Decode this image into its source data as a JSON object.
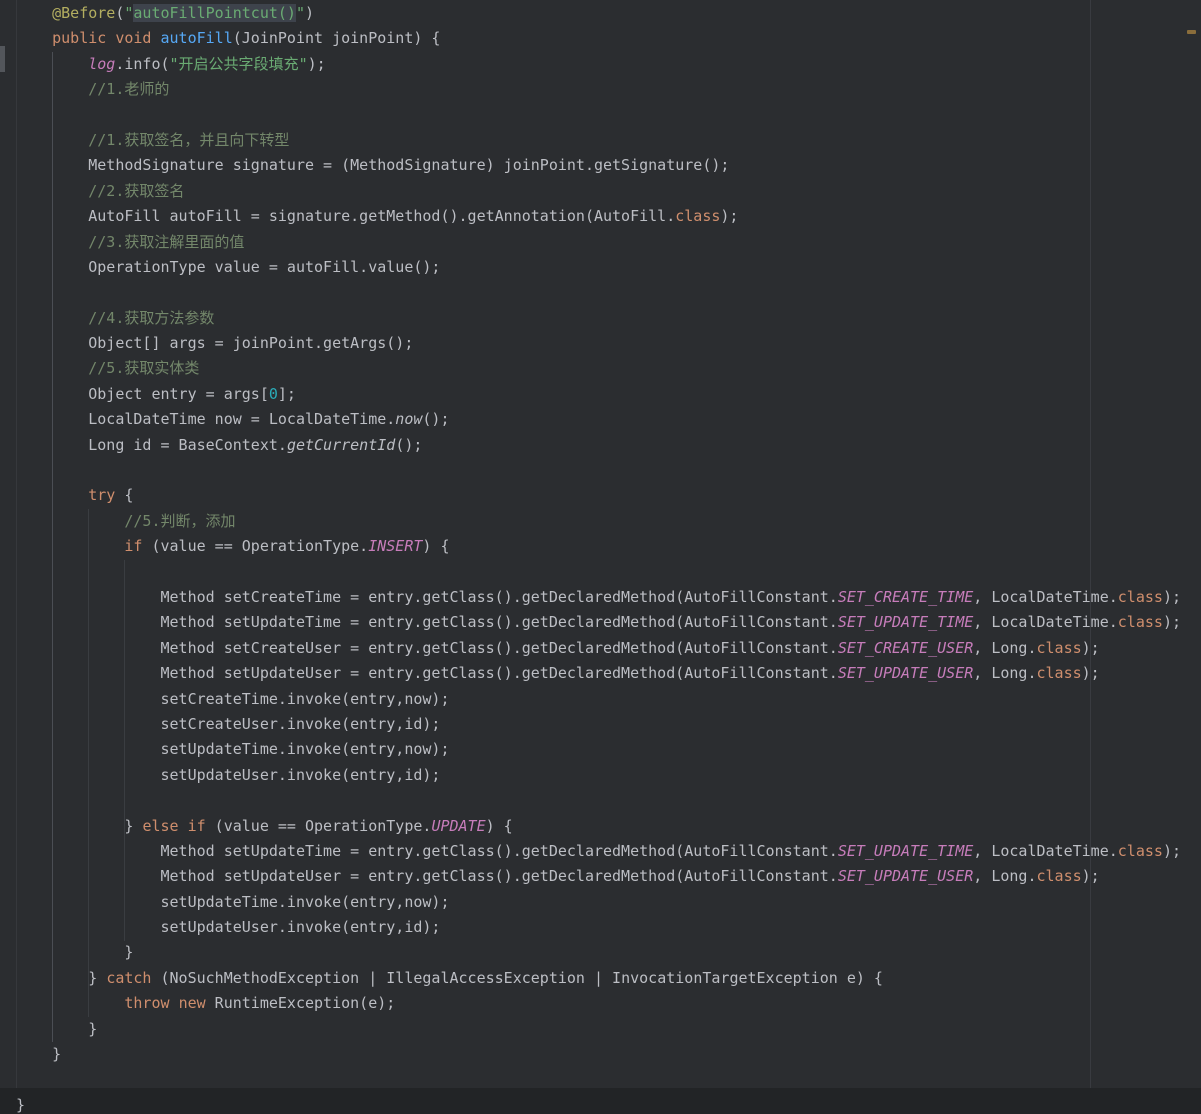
{
  "app": {
    "kind": "code-editor",
    "language": "java"
  },
  "editor": {
    "background": "#2b2d30",
    "default_text_color": "#bcbec4",
    "indent_guide_color": "#3a3d41",
    "active_indent_guide_color": "#4b4e54",
    "right_margin_guide_color": "#393b40",
    "bottom_band_color": "#222426",
    "identifier_highlight_bg": "#3e434c",
    "token_colors": {
      "p": {
        "color": "#bcbec4"
      },
      "k": {
        "color": "#cf8e6d"
      },
      "a": {
        "color": "#b3ae60"
      },
      "s": {
        "color": "#6aab73"
      },
      "sh": {
        "color": "#6aab73",
        "bg": "#3e434c"
      },
      "c": {
        "color": "#73876a"
      },
      "t": {
        "color": "#c77dbb",
        "italic": true
      },
      "m": {
        "color": "#56a8f5"
      },
      "i": {
        "color": "#bcbec4",
        "italic": true
      },
      "n": {
        "color": "#2aacb8"
      }
    },
    "lines": [
      {
        "tokens": [
          [
            "p",
            "    "
          ],
          [
            "a",
            "@Before"
          ],
          [
            "p",
            "("
          ],
          [
            "s",
            "\""
          ],
          [
            "sh",
            "autoFillPointcut()"
          ],
          [
            "s",
            "\""
          ],
          [
            "p",
            ")"
          ]
        ]
      },
      {
        "tokens": [
          [
            "p",
            "    "
          ],
          [
            "k",
            "public"
          ],
          [
            "p",
            " "
          ],
          [
            "k",
            "void"
          ],
          [
            "p",
            " "
          ],
          [
            "m",
            "autoFill"
          ],
          [
            "p",
            "(JoinPoint joinPoint) {"
          ]
        ]
      },
      {
        "tokens": [
          [
            "p",
            "        "
          ],
          [
            "t",
            "log"
          ],
          [
            "p",
            ".info("
          ],
          [
            "s",
            "\"开启公共字段填充\""
          ],
          [
            "p",
            ");"
          ]
        ]
      },
      {
        "tokens": [
          [
            "p",
            "        "
          ],
          [
            "c",
            "//1.老师的"
          ]
        ]
      },
      {
        "tokens": []
      },
      {
        "tokens": [
          [
            "p",
            "        "
          ],
          [
            "c",
            "//1.获取签名，并且向下转型"
          ]
        ]
      },
      {
        "tokens": [
          [
            "p",
            "        MethodSignature signature = (MethodSignature) joinPoint.getSignature();"
          ]
        ]
      },
      {
        "tokens": [
          [
            "p",
            "        "
          ],
          [
            "c",
            "//2.获取签名"
          ]
        ]
      },
      {
        "tokens": [
          [
            "p",
            "        AutoFill autoFill = signature.getMethod().getAnnotation(AutoFill."
          ],
          [
            "k",
            "class"
          ],
          [
            "p",
            ");"
          ]
        ]
      },
      {
        "tokens": [
          [
            "p",
            "        "
          ],
          [
            "c",
            "//3.获取注解里面的值"
          ]
        ]
      },
      {
        "tokens": [
          [
            "p",
            "        OperationType value = autoFill.value();"
          ]
        ]
      },
      {
        "tokens": []
      },
      {
        "tokens": [
          [
            "p",
            "        "
          ],
          [
            "c",
            "//4.获取方法参数"
          ]
        ]
      },
      {
        "tokens": [
          [
            "p",
            "        Object[] args = joinPoint.getArgs();"
          ]
        ]
      },
      {
        "tokens": [
          [
            "p",
            "        "
          ],
          [
            "c",
            "//5.获取实体类"
          ]
        ]
      },
      {
        "tokens": [
          [
            "p",
            "        Object entry = args["
          ],
          [
            "n",
            "0"
          ],
          [
            "p",
            "];"
          ]
        ]
      },
      {
        "tokens": [
          [
            "p",
            "        LocalDateTime now = LocalDateTime."
          ],
          [
            "i",
            "now"
          ],
          [
            "p",
            "();"
          ]
        ]
      },
      {
        "tokens": [
          [
            "p",
            "        Long id = BaseContext."
          ],
          [
            "i",
            "getCurrentId"
          ],
          [
            "p",
            "();"
          ]
        ]
      },
      {
        "tokens": []
      },
      {
        "tokens": [
          [
            "p",
            "        "
          ],
          [
            "k",
            "try"
          ],
          [
            "p",
            " {"
          ]
        ]
      },
      {
        "tokens": [
          [
            "p",
            "            "
          ],
          [
            "c",
            "//5.判断，添加"
          ]
        ]
      },
      {
        "tokens": [
          [
            "p",
            "            "
          ],
          [
            "k",
            "if"
          ],
          [
            "p",
            " (value == OperationType."
          ],
          [
            "t",
            "INSERT"
          ],
          [
            "p",
            ") {"
          ]
        ]
      },
      {
        "tokens": []
      },
      {
        "tokens": [
          [
            "p",
            "                Method setCreateTime = entry.getClass().getDeclaredMethod(AutoFillConstant."
          ],
          [
            "t",
            "SET_CREATE_TIME"
          ],
          [
            "p",
            ", LocalDateTime."
          ],
          [
            "k",
            "class"
          ],
          [
            "p",
            ");"
          ]
        ]
      },
      {
        "tokens": [
          [
            "p",
            "                Method setUpdateTime = entry.getClass().getDeclaredMethod(AutoFillConstant."
          ],
          [
            "t",
            "SET_UPDATE_TIME"
          ],
          [
            "p",
            ", LocalDateTime."
          ],
          [
            "k",
            "class"
          ],
          [
            "p",
            ");"
          ]
        ]
      },
      {
        "tokens": [
          [
            "p",
            "                Method setCreateUser = entry.getClass().getDeclaredMethod(AutoFillConstant."
          ],
          [
            "t",
            "SET_CREATE_USER"
          ],
          [
            "p",
            ", Long."
          ],
          [
            "k",
            "class"
          ],
          [
            "p",
            ");"
          ]
        ]
      },
      {
        "tokens": [
          [
            "p",
            "                Method setUpdateUser = entry.getClass().getDeclaredMethod(AutoFillConstant."
          ],
          [
            "t",
            "SET_UPDATE_USER"
          ],
          [
            "p",
            ", Long."
          ],
          [
            "k",
            "class"
          ],
          [
            "p",
            ");"
          ]
        ]
      },
      {
        "tokens": [
          [
            "p",
            "                setCreateTime.invoke(entry,now);"
          ]
        ]
      },
      {
        "tokens": [
          [
            "p",
            "                setCreateUser.invoke(entry,id);"
          ]
        ]
      },
      {
        "tokens": [
          [
            "p",
            "                setUpdateTime.invoke(entry,now);"
          ]
        ]
      },
      {
        "tokens": [
          [
            "p",
            "                setUpdateUser.invoke(entry,id);"
          ]
        ]
      },
      {
        "tokens": []
      },
      {
        "tokens": [
          [
            "p",
            "            } "
          ],
          [
            "k",
            "else"
          ],
          [
            "p",
            " "
          ],
          [
            "k",
            "if"
          ],
          [
            "p",
            " (value == OperationType."
          ],
          [
            "t",
            "UPDATE"
          ],
          [
            "p",
            ") {"
          ]
        ]
      },
      {
        "tokens": [
          [
            "p",
            "                Method setUpdateTime = entry.getClass().getDeclaredMethod(AutoFillConstant."
          ],
          [
            "t",
            "SET_UPDATE_TIME"
          ],
          [
            "p",
            ", LocalDateTime."
          ],
          [
            "k",
            "class"
          ],
          [
            "p",
            ");"
          ]
        ]
      },
      {
        "tokens": [
          [
            "p",
            "                Method setUpdateUser = entry.getClass().getDeclaredMethod(AutoFillConstant."
          ],
          [
            "t",
            "SET_UPDATE_USER"
          ],
          [
            "p",
            ", Long."
          ],
          [
            "k",
            "class"
          ],
          [
            "p",
            ");"
          ]
        ]
      },
      {
        "tokens": [
          [
            "p",
            "                setUpdateTime.invoke(entry,now);"
          ]
        ]
      },
      {
        "tokens": [
          [
            "p",
            "                setUpdateUser.invoke(entry,id);"
          ]
        ]
      },
      {
        "tokens": [
          [
            "p",
            "            }"
          ]
        ]
      },
      {
        "tokens": [
          [
            "p",
            "        } "
          ],
          [
            "k",
            "catch"
          ],
          [
            "p",
            " (NoSuchMethodException | IllegalAccessException | InvocationTargetException e) {"
          ]
        ]
      },
      {
        "tokens": [
          [
            "p",
            "            "
          ],
          [
            "k",
            "throw"
          ],
          [
            "p",
            " "
          ],
          [
            "k",
            "new"
          ],
          [
            "p",
            " RuntimeException(e);"
          ]
        ]
      },
      {
        "tokens": [
          [
            "p",
            "        }"
          ]
        ]
      },
      {
        "tokens": [
          [
            "p",
            "    }"
          ]
        ]
      },
      {
        "tokens": []
      },
      {
        "tokens": [
          [
            "p",
            "}"
          ]
        ]
      }
    ]
  }
}
